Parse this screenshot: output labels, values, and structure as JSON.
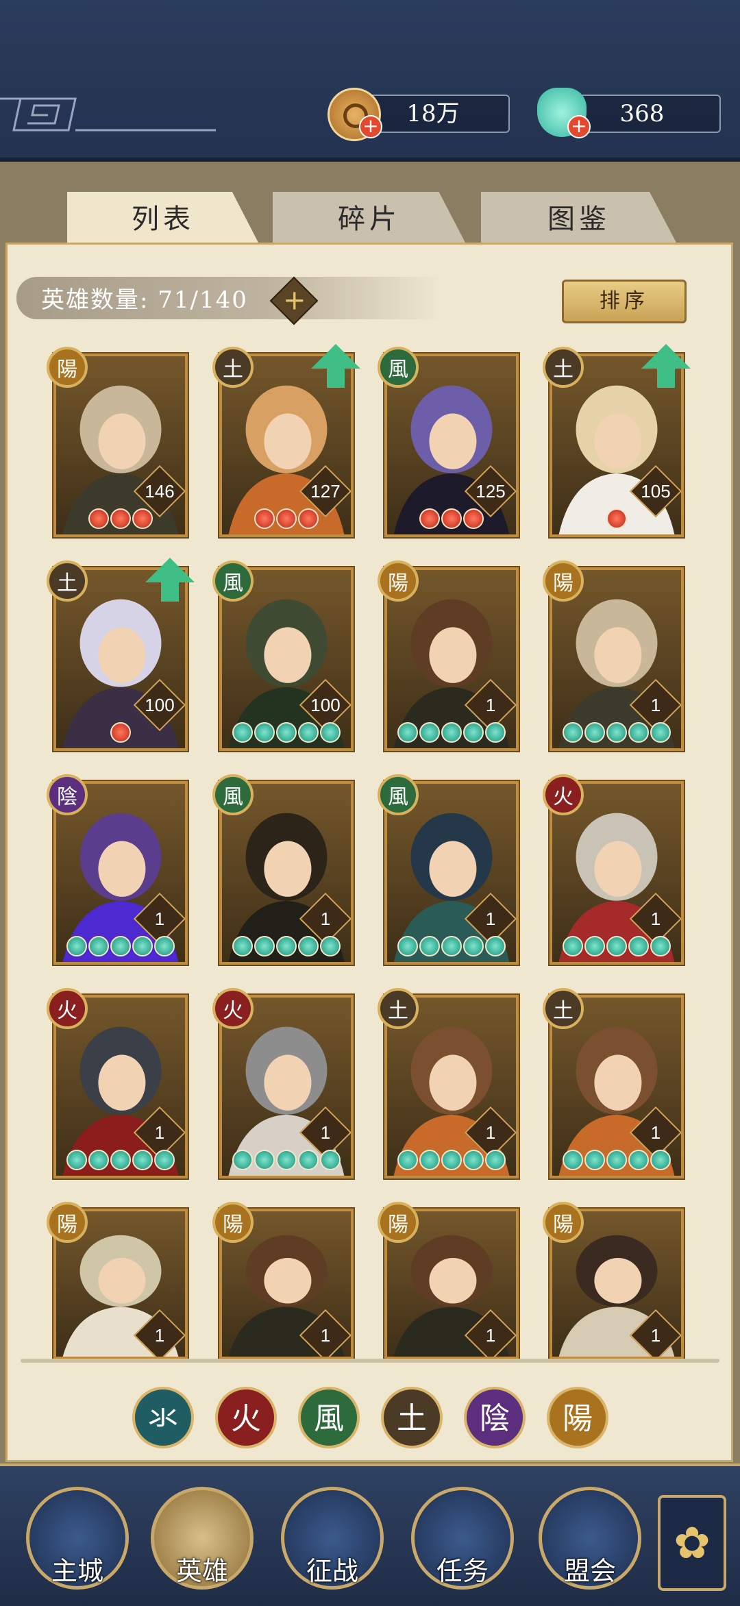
{
  "resources": {
    "coins": "18万",
    "jade": "368"
  },
  "tabs": [
    {
      "label": "列表",
      "active": true
    },
    {
      "label": "碎片",
      "active": false
    },
    {
      "label": "图鉴",
      "active": false
    }
  ],
  "hero_count_label": "英雄数量: 71/140",
  "add_button": "+",
  "sort_button": "排序",
  "elements": {
    "water": {
      "glyph": "氺",
      "color": "#1f5d63"
    },
    "fire": {
      "glyph": "火",
      "color": "#8a1f1f"
    },
    "wind": {
      "glyph": "風",
      "color": "#2d6b3c"
    },
    "earth": {
      "glyph": "土",
      "color": "#4a3a26"
    },
    "yin": {
      "glyph": "陰",
      "color": "#5b2f7d"
    },
    "yang": {
      "glyph": "陽",
      "color": "#a8721e"
    }
  },
  "heroes": [
    {
      "element_glyph": "陽",
      "level": "146",
      "stars": "red3",
      "upgrade": false
    },
    {
      "element_glyph": "土",
      "level": "127",
      "stars": "red3",
      "upgrade": true
    },
    {
      "element_glyph": "風",
      "level": "125",
      "stars": "red3",
      "upgrade": false
    },
    {
      "element_glyph": "土",
      "level": "105",
      "stars": "red1",
      "upgrade": true
    },
    {
      "element_glyph": "土",
      "level": "100",
      "stars": "red1",
      "upgrade": true
    },
    {
      "element_glyph": "風",
      "level": "100",
      "stars": "green5",
      "upgrade": false
    },
    {
      "element_glyph": "陽",
      "level": "1",
      "stars": "green5",
      "upgrade": false
    },
    {
      "element_glyph": "陽",
      "level": "1",
      "stars": "green5",
      "upgrade": false
    },
    {
      "element_glyph": "陰",
      "level": "1",
      "stars": "green5",
      "upgrade": false
    },
    {
      "element_glyph": "風",
      "level": "1",
      "stars": "green5",
      "upgrade": false
    },
    {
      "element_glyph": "風",
      "level": "1",
      "stars": "green5",
      "upgrade": false
    },
    {
      "element_glyph": "火",
      "level": "1",
      "stars": "green5",
      "upgrade": false
    },
    {
      "element_glyph": "火",
      "level": "1",
      "stars": "green5",
      "upgrade": false
    },
    {
      "element_glyph": "火",
      "level": "1",
      "stars": "green5",
      "upgrade": false
    },
    {
      "element_glyph": "土",
      "level": "1",
      "stars": "green5",
      "upgrade": false
    },
    {
      "element_glyph": "土",
      "level": "1",
      "stars": "green5",
      "upgrade": false
    },
    {
      "element_glyph": "陽",
      "level": "1",
      "stars": "",
      "upgrade": false
    },
    {
      "element_glyph": "陽",
      "level": "1",
      "stars": "",
      "upgrade": false
    },
    {
      "element_glyph": "陽",
      "level": "1",
      "stars": "",
      "upgrade": false
    },
    {
      "element_glyph": "陽",
      "level": "1",
      "stars": "",
      "upgrade": false
    }
  ],
  "filters": [
    "氺",
    "火",
    "風",
    "土",
    "陰",
    "陽"
  ],
  "nav": [
    {
      "label": "主城",
      "icon": "castle-icon"
    },
    {
      "label": "英雄",
      "icon": "hero-icon",
      "active": true
    },
    {
      "label": "征战",
      "icon": "battle-icon"
    },
    {
      "label": "任务",
      "icon": "scroll-icon"
    },
    {
      "label": "盟会",
      "icon": "alliance-icon"
    }
  ],
  "more_icon": "flower-menu-icon"
}
